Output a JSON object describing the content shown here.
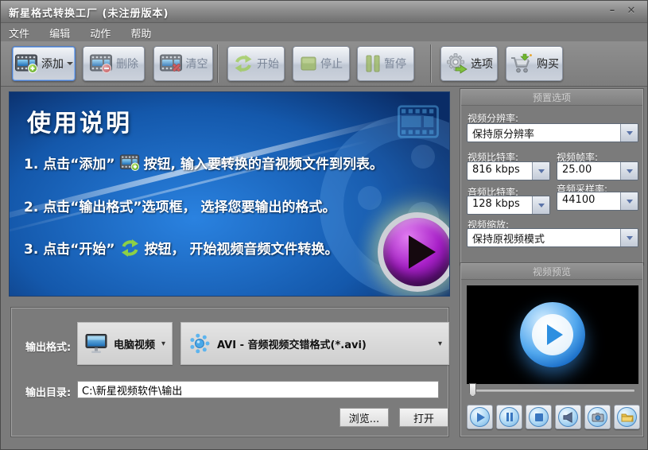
{
  "window": {
    "title": "新星格式转换工厂  (未注册版本)"
  },
  "icons": {
    "minimize": "–",
    "close": "✕",
    "caret_down": "▾",
    "add": "film-plus-icon",
    "delete": "film-minus-icon",
    "clear": "film-x-icon",
    "start": "refresh-arrows-icon",
    "stop": "green-square-icon",
    "pause": "green-pause-icon",
    "options": "gear-arrow-icon",
    "buy": "cart-icon",
    "device": "monitor-icon",
    "format": "blue-dots-icon"
  },
  "colors": {
    "panel_blue": "#1565c0",
    "green_accent": "#8dc63f",
    "purple_play": "#a820c8",
    "preview_blue": "#2d8fe0",
    "bg_gray": "#7b7b7b"
  },
  "menu": {
    "items": [
      "文件",
      "编辑",
      "动作",
      "帮助"
    ]
  },
  "toolbar": {
    "add": "添加",
    "delete": "删除",
    "clear": "清空",
    "start": "开始",
    "stop": "停止",
    "pause": "暂停",
    "options": "选项",
    "buy": "购买"
  },
  "instructions": {
    "title": "使用说明",
    "step1_pre": "1. 点击“添加”",
    "step1_post": "按钮, 输入要转换的音视频文件到列表。",
    "step2": "2. 点击“输出格式”选项框， 选择您要输出的格式。",
    "step3_pre": "3. 点击“开始”",
    "step3_post": "按钮， 开始视频音频文件转换。"
  },
  "presets": {
    "header": "预置选项",
    "resolution_label": "视频分辨率:",
    "resolution_value": "保持原分辨率",
    "vbitrate_label": "视频比特率:",
    "vbitrate_value": "816 kbps",
    "framerate_label": "视频帧率:",
    "framerate_value": "25.00",
    "abitrate_label": "音频比特率:",
    "abitrate_value": "128 kbps",
    "samplerate_label": "音频采样率:",
    "samplerate_value": "44100",
    "scale_label": "视频缩放:",
    "scale_value": "保持原视频模式"
  },
  "preview": {
    "header": "视频预览"
  },
  "output": {
    "format_label": "输出格式:",
    "device_value": "电脑视频",
    "format_value": "AVI - 音频视频交错格式(*.avi)",
    "dir_label": "输出目录:",
    "dir_value": "C:\\新星视频软件\\输出",
    "browse": "浏览...",
    "open": "打开"
  }
}
